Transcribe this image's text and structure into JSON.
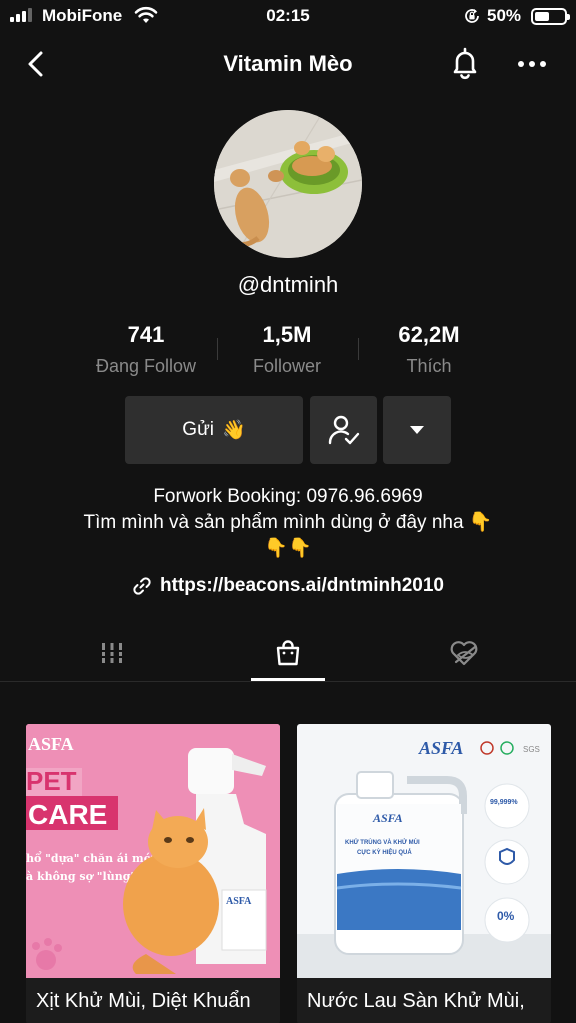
{
  "status_bar": {
    "carrier": "MobiFone",
    "time": "02:15",
    "battery_percent": "50%",
    "battery_level": 0.5
  },
  "header": {
    "title": "Vitamin Mèo"
  },
  "profile": {
    "username": "@dntminh",
    "stats": [
      {
        "value": "741",
        "label": "Đang Follow"
      },
      {
        "value": "1,5M",
        "label": "Follower"
      },
      {
        "value": "62,2M",
        "label": "Thích"
      }
    ],
    "message_button_label": "Gửi",
    "message_button_emoji": "👋",
    "bio_line1": "Forwork Booking: 0976.96.6969",
    "bio_line2": "Tìm mình và sản phẩm mình dùng ở đây nha 👇",
    "bio_line3": "👇👇",
    "link": "https://beacons.ai/dntminh2010"
  },
  "tabs": [
    {
      "icon": "grid-icon",
      "active": false
    },
    {
      "icon": "shopping-bag-icon",
      "active": true
    },
    {
      "icon": "liked-hidden-icon",
      "active": false
    }
  ],
  "products": [
    {
      "title": "Xịt Khử Mùi, Diệt Khuẩn",
      "image": {
        "brand": "ASFA",
        "headline1": "PET",
        "headline2": "CARE",
        "tagline1": "hổ \"dựa\" chăn ái mới",
        "tagline2": "à không sợ \"lùng\"",
        "accent": "#ee8fb6"
      }
    },
    {
      "title": "Nước Lau Sàn Khử Mùi,",
      "image": {
        "brand": "ASFA",
        "badge1": "TIÊN DIỆT 99,999% VI KHUẨN",
        "badge2": "KHỬ MÙI MẠNH MẼ",
        "badge3": "0% ALCOHOL KHÔNG HÓA CHẤT",
        "jug_line1": "KHỬ TRÙNG VÀ KHỬ MÙI",
        "jug_line2": "CỰC KỲ HIỆU QUẢ",
        "accent": "#2e5aa8"
      }
    }
  ]
}
